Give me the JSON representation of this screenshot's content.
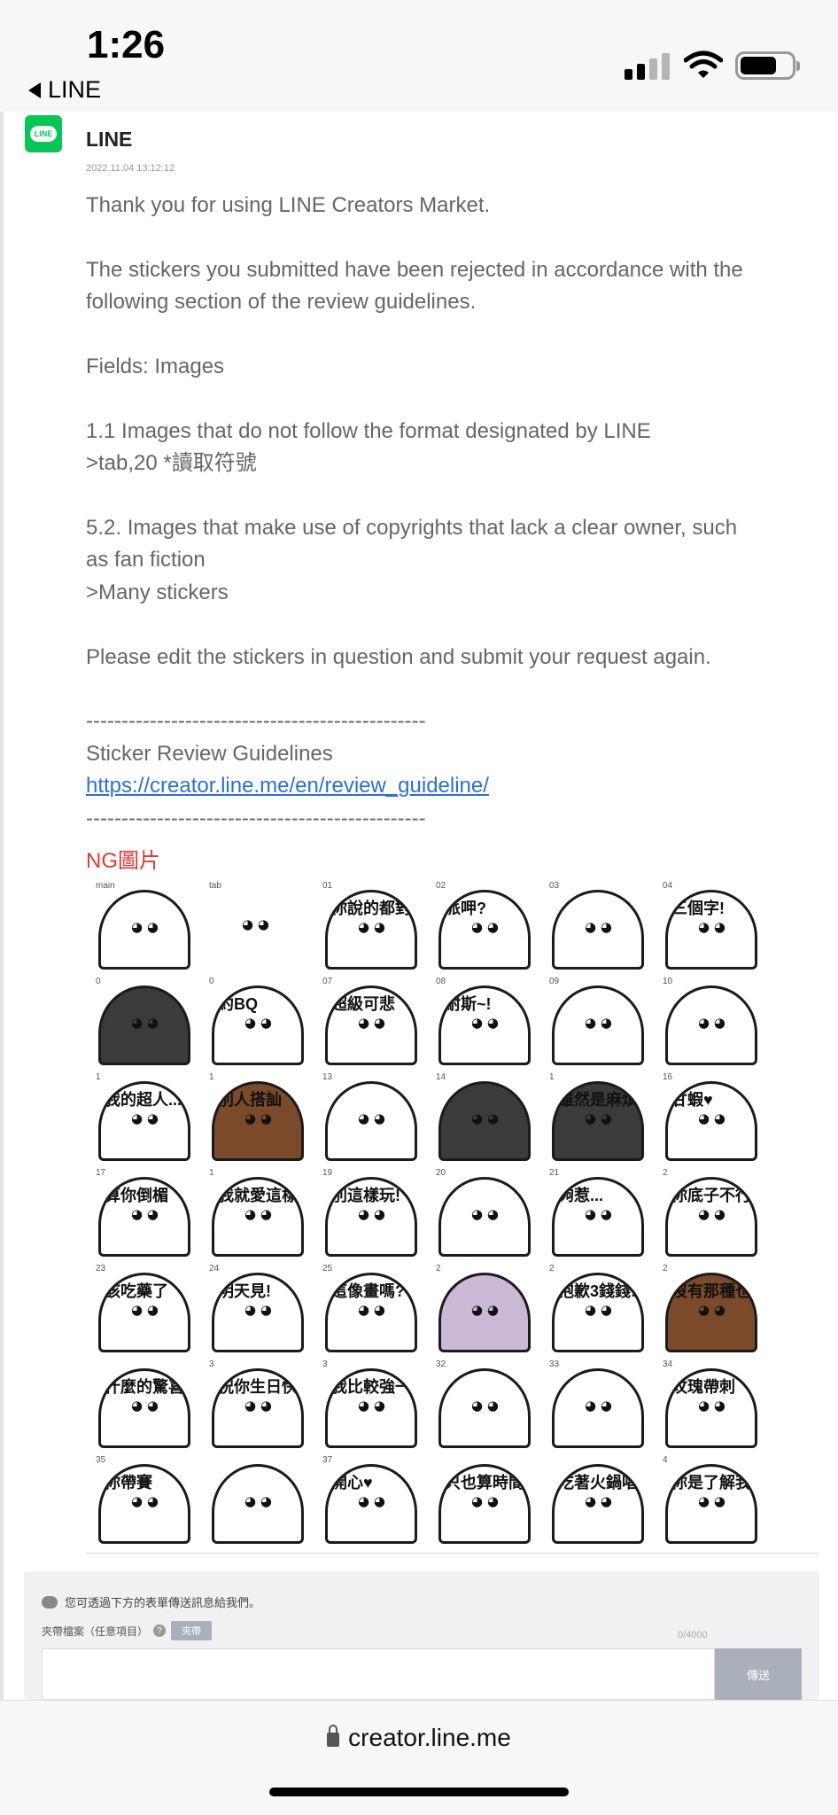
{
  "status_bar": {
    "time": "1:26",
    "back_label": "LINE",
    "icons": [
      "signal-icon",
      "wifi-icon",
      "battery-icon"
    ]
  },
  "message": {
    "sender": "LINE",
    "timestamp": "2022.11.04 13:12:12",
    "avatar_text": "LINE",
    "lines": [
      "Thank you for using LINE Creators Market.",
      "The stickers you submitted have been rejected in accordance with the",
      "following section of the review guidelines.",
      "Fields: Images",
      "1.1 Images that do not follow the format designated by LINE",
      ">tab,20 *讀取符號",
      "5.2. Images that make use of copyrights that lack a clear owner, such",
      "as fan fiction",
      ">Many stickers",
      "Please edit the stickers in question and submit your request again.",
      "------------------------------------------------",
      "Sticker Review Guidelines"
    ],
    "link": "https://creator.line.me/en/review_guideline/",
    "separator": "------------------------------------------------",
    "ng_label": "NG圖片"
  },
  "stickers": [
    {
      "num": "main",
      "caption": ""
    },
    {
      "num": "tab",
      "caption": ""
    },
    {
      "num": "01",
      "caption": "你說的都對。"
    },
    {
      "num": "02",
      "caption": "派呷?"
    },
    {
      "num": "03",
      "caption": ""
    },
    {
      "num": "04",
      "caption": "三個字!"
    },
    {
      "num": "0",
      "caption": ""
    },
    {
      "num": "0",
      "caption": "約BQ"
    },
    {
      "num": "07",
      "caption": "超級可悲"
    },
    {
      "num": "08",
      "caption": "耐斯~!"
    },
    {
      "num": "09",
      "caption": ""
    },
    {
      "num": "10",
      "caption": ""
    },
    {
      "num": "1",
      "caption": "我的超人...!"
    },
    {
      "num": "1",
      "caption": "別人搭訕"
    },
    {
      "num": "13",
      "caption": ""
    },
    {
      "num": "14",
      "caption": ""
    },
    {
      "num": "1",
      "caption": "雖然是麻煩的成朱"
    },
    {
      "num": "16",
      "caption": "甘蝦♥"
    },
    {
      "num": "17",
      "caption": "算你倒楣"
    },
    {
      "num": "1",
      "caption": "我就愛這樣玩!"
    },
    {
      "num": "19",
      "caption": "別這樣玩!"
    },
    {
      "num": "20",
      "caption": ""
    },
    {
      "num": "21",
      "caption": "夠惹..."
    },
    {
      "num": "2",
      "caption": "你底子不行"
    },
    {
      "num": "23",
      "caption": "該吃藥了"
    },
    {
      "num": "24",
      "caption": "明天見!"
    },
    {
      "num": "25",
      "caption": "這像畫嗎?"
    },
    {
      "num": "2",
      "caption": ""
    },
    {
      "num": "2",
      "caption": "抱歉3錢錢!"
    },
    {
      "num": "2",
      "caption": "沒有那種也沒錢"
    },
    {
      "num": "",
      "caption": "什麼的驚喜"
    },
    {
      "num": "3",
      "caption": "祝你生日快樂。"
    },
    {
      "num": "3",
      "caption": "我比較強一點點"
    },
    {
      "num": "32",
      "caption": ""
    },
    {
      "num": "33",
      "caption": ""
    },
    {
      "num": "34",
      "caption": "玫瑰帶刺"
    },
    {
      "num": "35",
      "caption": "你帶賽"
    },
    {
      "num": "",
      "caption": ""
    },
    {
      "num": "37",
      "caption": "開心♥"
    },
    {
      "num": "",
      "caption": "只也算時間喔。"
    },
    {
      "num": "",
      "caption": "吃著火鍋唱著歌"
    },
    {
      "num": "4",
      "caption": "你是了解我的!"
    }
  ],
  "form": {
    "note": "您可透過下方的表單傳送訊息給我們。",
    "attach_label": "夾帶檔案（任意項目）",
    "attach_button": "夾帶",
    "counter": "0/4000",
    "send_button": "傳送"
  },
  "url_bar": {
    "url": "creator.line.me"
  }
}
